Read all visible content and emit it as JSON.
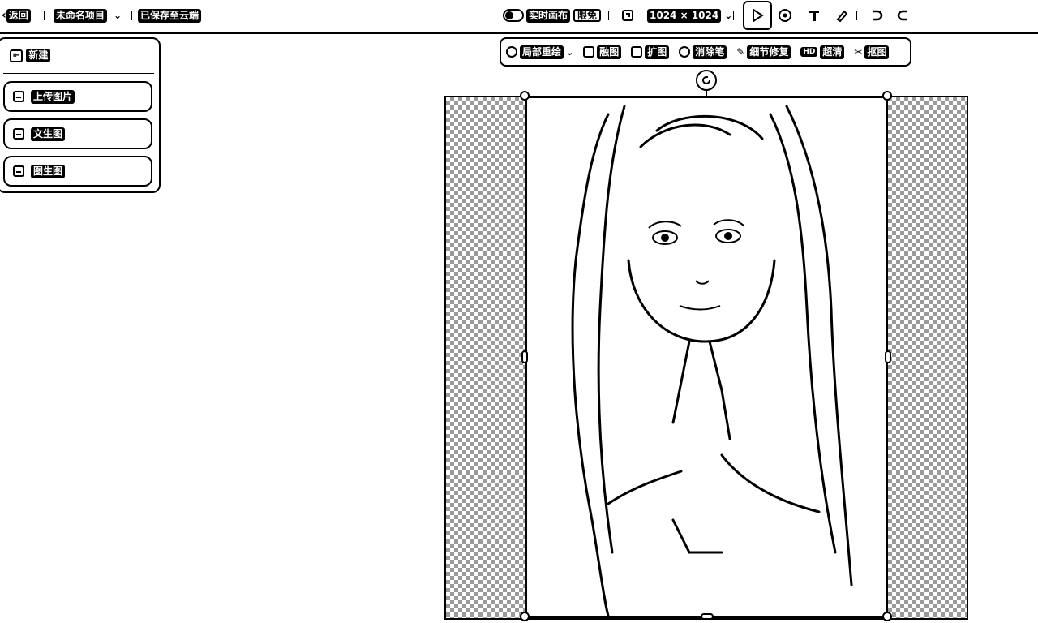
{
  "header": {
    "back_label": "返回",
    "project_name": "未命名项目",
    "save_status": "已保存至云端",
    "realtime_label": "实时画布",
    "realtime_badge": "限免",
    "size_label": "1024 × 1024"
  },
  "sidebar": {
    "new_label": "新建",
    "items": [
      {
        "label": "上传图片",
        "icon": "upload-image-icon"
      },
      {
        "label": "文生图",
        "icon": "text-to-image-icon"
      },
      {
        "label": "图生图",
        "icon": "image-to-image-icon"
      }
    ]
  },
  "edit_toolbar": {
    "items": [
      {
        "label": "局部重绘",
        "icon": "brush-icon"
      },
      {
        "label": "融图",
        "icon": "merge-icon"
      },
      {
        "label": "扩图",
        "icon": "expand-icon"
      },
      {
        "label": "消除笔",
        "icon": "eraser-icon"
      },
      {
        "label": "细节修复",
        "icon": "wand-icon"
      },
      {
        "label": "超清",
        "icon": "hd-icon",
        "badge": "HD"
      },
      {
        "label": "抠图",
        "icon": "cutout-icon"
      }
    ]
  },
  "tools": [
    "select-tool-icon",
    "hand-tool-icon",
    "text-tool-icon",
    "pen-tool-icon",
    "undo-icon",
    "redo-icon"
  ]
}
